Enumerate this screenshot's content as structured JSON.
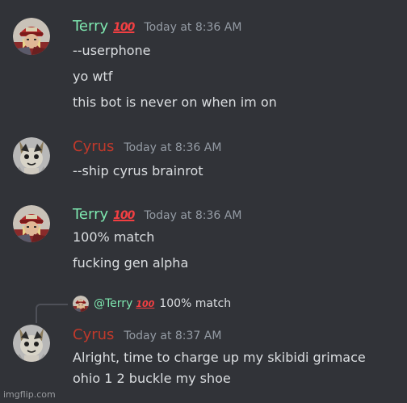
{
  "colors": {
    "background": "#313338",
    "terry_name": "#7ee8b0",
    "cyrus_name": "#c0392b",
    "timestamp": "#949ba4",
    "emoji_red": "#f23f42"
  },
  "messages": [
    {
      "author": "Terry",
      "badge": "💯",
      "time": "Today at 8:36 AM",
      "avatar_icon": "terry-avatar-icon",
      "lines": [
        "--userphone",
        "yo wtf",
        "this bot is never on when im on"
      ]
    },
    {
      "author": "Cyrus",
      "time": "Today at 8:36 AM",
      "avatar_icon": "cyrus-avatar-icon",
      "lines": [
        "--ship cyrus brainrot"
      ]
    },
    {
      "author": "Terry",
      "badge": "💯",
      "time": "Today at 8:36 AM",
      "avatar_icon": "terry-avatar-icon",
      "lines": [
        "100% match",
        "fucking gen alpha"
      ]
    },
    {
      "reply": {
        "mention": "@Terry",
        "badge": "💯",
        "text": "100% match"
      },
      "author": "Cyrus",
      "time": "Today at 8:37 AM",
      "avatar_icon": "cyrus-avatar-icon",
      "lines": [
        "Alright, time to charge up my skibidi grimace",
        "ohio 1 2 buckle my shoe"
      ]
    }
  ],
  "watermark": "imgflip.com"
}
